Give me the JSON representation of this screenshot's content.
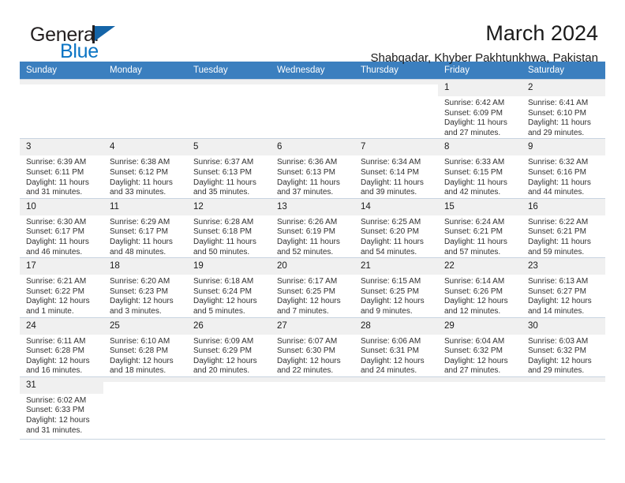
{
  "brand": {
    "name_top": "General",
    "name_bottom": "Blue",
    "flag_color": "#1565a8",
    "text_color": "#0a74c4"
  },
  "header": {
    "title": "March 2024",
    "subtitle": "Shabqadar, Khyber Pakhtunkhwa, Pakistan"
  },
  "theme": {
    "header_row_bg": "#3b7fbf",
    "daynum_bg": "#f0f0f0",
    "grid_line": "#c8d4e0"
  },
  "weekdays": [
    "Sunday",
    "Monday",
    "Tuesday",
    "Wednesday",
    "Thursday",
    "Friday",
    "Saturday"
  ],
  "weeks": [
    [
      {
        "day": "",
        "empty": true
      },
      {
        "day": "",
        "empty": true
      },
      {
        "day": "",
        "empty": true
      },
      {
        "day": "",
        "empty": true
      },
      {
        "day": "",
        "empty": true
      },
      {
        "day": "1",
        "sunrise": "Sunrise: 6:42 AM",
        "sunset": "Sunset: 6:09 PM",
        "daylight": "Daylight: 11 hours and 27 minutes."
      },
      {
        "day": "2",
        "sunrise": "Sunrise: 6:41 AM",
        "sunset": "Sunset: 6:10 PM",
        "daylight": "Daylight: 11 hours and 29 minutes."
      }
    ],
    [
      {
        "day": "3",
        "sunrise": "Sunrise: 6:39 AM",
        "sunset": "Sunset: 6:11 PM",
        "daylight": "Daylight: 11 hours and 31 minutes."
      },
      {
        "day": "4",
        "sunrise": "Sunrise: 6:38 AM",
        "sunset": "Sunset: 6:12 PM",
        "daylight": "Daylight: 11 hours and 33 minutes."
      },
      {
        "day": "5",
        "sunrise": "Sunrise: 6:37 AM",
        "sunset": "Sunset: 6:13 PM",
        "daylight": "Daylight: 11 hours and 35 minutes."
      },
      {
        "day": "6",
        "sunrise": "Sunrise: 6:36 AM",
        "sunset": "Sunset: 6:13 PM",
        "daylight": "Daylight: 11 hours and 37 minutes."
      },
      {
        "day": "7",
        "sunrise": "Sunrise: 6:34 AM",
        "sunset": "Sunset: 6:14 PM",
        "daylight": "Daylight: 11 hours and 39 minutes."
      },
      {
        "day": "8",
        "sunrise": "Sunrise: 6:33 AM",
        "sunset": "Sunset: 6:15 PM",
        "daylight": "Daylight: 11 hours and 42 minutes."
      },
      {
        "day": "9",
        "sunrise": "Sunrise: 6:32 AM",
        "sunset": "Sunset: 6:16 PM",
        "daylight": "Daylight: 11 hours and 44 minutes."
      }
    ],
    [
      {
        "day": "10",
        "sunrise": "Sunrise: 6:30 AM",
        "sunset": "Sunset: 6:17 PM",
        "daylight": "Daylight: 11 hours and 46 minutes."
      },
      {
        "day": "11",
        "sunrise": "Sunrise: 6:29 AM",
        "sunset": "Sunset: 6:17 PM",
        "daylight": "Daylight: 11 hours and 48 minutes."
      },
      {
        "day": "12",
        "sunrise": "Sunrise: 6:28 AM",
        "sunset": "Sunset: 6:18 PM",
        "daylight": "Daylight: 11 hours and 50 minutes."
      },
      {
        "day": "13",
        "sunrise": "Sunrise: 6:26 AM",
        "sunset": "Sunset: 6:19 PM",
        "daylight": "Daylight: 11 hours and 52 minutes."
      },
      {
        "day": "14",
        "sunrise": "Sunrise: 6:25 AM",
        "sunset": "Sunset: 6:20 PM",
        "daylight": "Daylight: 11 hours and 54 minutes."
      },
      {
        "day": "15",
        "sunrise": "Sunrise: 6:24 AM",
        "sunset": "Sunset: 6:21 PM",
        "daylight": "Daylight: 11 hours and 57 minutes."
      },
      {
        "day": "16",
        "sunrise": "Sunrise: 6:22 AM",
        "sunset": "Sunset: 6:21 PM",
        "daylight": "Daylight: 11 hours and 59 minutes."
      }
    ],
    [
      {
        "day": "17",
        "sunrise": "Sunrise: 6:21 AM",
        "sunset": "Sunset: 6:22 PM",
        "daylight": "Daylight: 12 hours and 1 minute."
      },
      {
        "day": "18",
        "sunrise": "Sunrise: 6:20 AM",
        "sunset": "Sunset: 6:23 PM",
        "daylight": "Daylight: 12 hours and 3 minutes."
      },
      {
        "day": "19",
        "sunrise": "Sunrise: 6:18 AM",
        "sunset": "Sunset: 6:24 PM",
        "daylight": "Daylight: 12 hours and 5 minutes."
      },
      {
        "day": "20",
        "sunrise": "Sunrise: 6:17 AM",
        "sunset": "Sunset: 6:25 PM",
        "daylight": "Daylight: 12 hours and 7 minutes."
      },
      {
        "day": "21",
        "sunrise": "Sunrise: 6:15 AM",
        "sunset": "Sunset: 6:25 PM",
        "daylight": "Daylight: 12 hours and 9 minutes."
      },
      {
        "day": "22",
        "sunrise": "Sunrise: 6:14 AM",
        "sunset": "Sunset: 6:26 PM",
        "daylight": "Daylight: 12 hours and 12 minutes."
      },
      {
        "day": "23",
        "sunrise": "Sunrise: 6:13 AM",
        "sunset": "Sunset: 6:27 PM",
        "daylight": "Daylight: 12 hours and 14 minutes."
      }
    ],
    [
      {
        "day": "24",
        "sunrise": "Sunrise: 6:11 AM",
        "sunset": "Sunset: 6:28 PM",
        "daylight": "Daylight: 12 hours and 16 minutes."
      },
      {
        "day": "25",
        "sunrise": "Sunrise: 6:10 AM",
        "sunset": "Sunset: 6:28 PM",
        "daylight": "Daylight: 12 hours and 18 minutes."
      },
      {
        "day": "26",
        "sunrise": "Sunrise: 6:09 AM",
        "sunset": "Sunset: 6:29 PM",
        "daylight": "Daylight: 12 hours and 20 minutes."
      },
      {
        "day": "27",
        "sunrise": "Sunrise: 6:07 AM",
        "sunset": "Sunset: 6:30 PM",
        "daylight": "Daylight: 12 hours and 22 minutes."
      },
      {
        "day": "28",
        "sunrise": "Sunrise: 6:06 AM",
        "sunset": "Sunset: 6:31 PM",
        "daylight": "Daylight: 12 hours and 24 minutes."
      },
      {
        "day": "29",
        "sunrise": "Sunrise: 6:04 AM",
        "sunset": "Sunset: 6:32 PM",
        "daylight": "Daylight: 12 hours and 27 minutes."
      },
      {
        "day": "30",
        "sunrise": "Sunrise: 6:03 AM",
        "sunset": "Sunset: 6:32 PM",
        "daylight": "Daylight: 12 hours and 29 minutes."
      }
    ],
    [
      {
        "day": "31",
        "sunrise": "Sunrise: 6:02 AM",
        "sunset": "Sunset: 6:33 PM",
        "daylight": "Daylight: 12 hours and 31 minutes."
      },
      {
        "day": "",
        "empty": true
      },
      {
        "day": "",
        "empty": true
      },
      {
        "day": "",
        "empty": true
      },
      {
        "day": "",
        "empty": true
      },
      {
        "day": "",
        "empty": true
      },
      {
        "day": "",
        "empty": true
      }
    ]
  ]
}
